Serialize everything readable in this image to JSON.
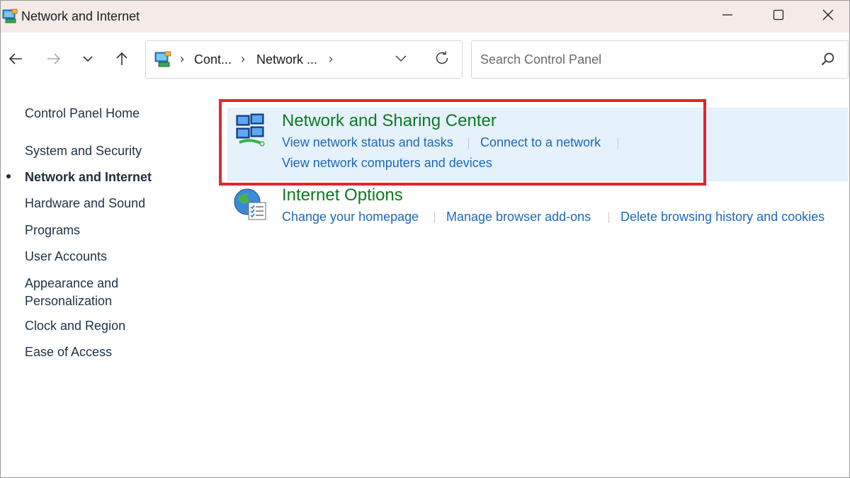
{
  "window": {
    "title": "Network and Internet",
    "icons": {
      "app": "control-panel-icon",
      "minimize": "minimize-icon",
      "maximize": "maximize-icon",
      "close": "close-icon"
    }
  },
  "navigation": {
    "back_icon": "arrow-left-icon",
    "forward_icon": "arrow-right-icon",
    "recent_icon": "chevron-down-icon",
    "up_icon": "arrow-up-icon",
    "breadcrumb": [
      "Cont...",
      "Network ..."
    ],
    "address_dropdown_icon": "chevron-down-icon",
    "refresh_icon": "refresh-icon"
  },
  "search": {
    "placeholder": "Search Control Panel",
    "value": "",
    "icon": "search-icon"
  },
  "sidebar": {
    "home": "Control Panel Home",
    "items": [
      {
        "label": "System and Security",
        "active": false
      },
      {
        "label": "Network and Internet",
        "active": true
      },
      {
        "label": "Hardware and Sound",
        "active": false
      },
      {
        "label": "Programs",
        "active": false
      },
      {
        "label": "User Accounts",
        "active": false
      },
      {
        "label": "Appearance and",
        "label2": "Personalization",
        "active": false
      },
      {
        "label": "Clock and Region",
        "active": false
      },
      {
        "label": "Ease of Access",
        "active": false
      }
    ]
  },
  "categories": [
    {
      "title": "Network and Sharing Center",
      "icon": "network-sharing-icon",
      "highlighted": true,
      "tasks": [
        "View network status and tasks",
        "Connect to a network",
        "View network computers and devices"
      ]
    },
    {
      "title": "Internet Options",
      "icon": "internet-options-globe-icon",
      "highlighted": false,
      "tasks": [
        "Change your homepage",
        "Manage browser add-ons",
        "Delete browsing history and cookies"
      ]
    }
  ],
  "colors": {
    "titlebar": "#f4ebe9",
    "category_title": "#0e7a24",
    "task_link": "#1d69b7",
    "highlight_bg": "#e5f1fb",
    "annotation_box": "#e0262f"
  }
}
